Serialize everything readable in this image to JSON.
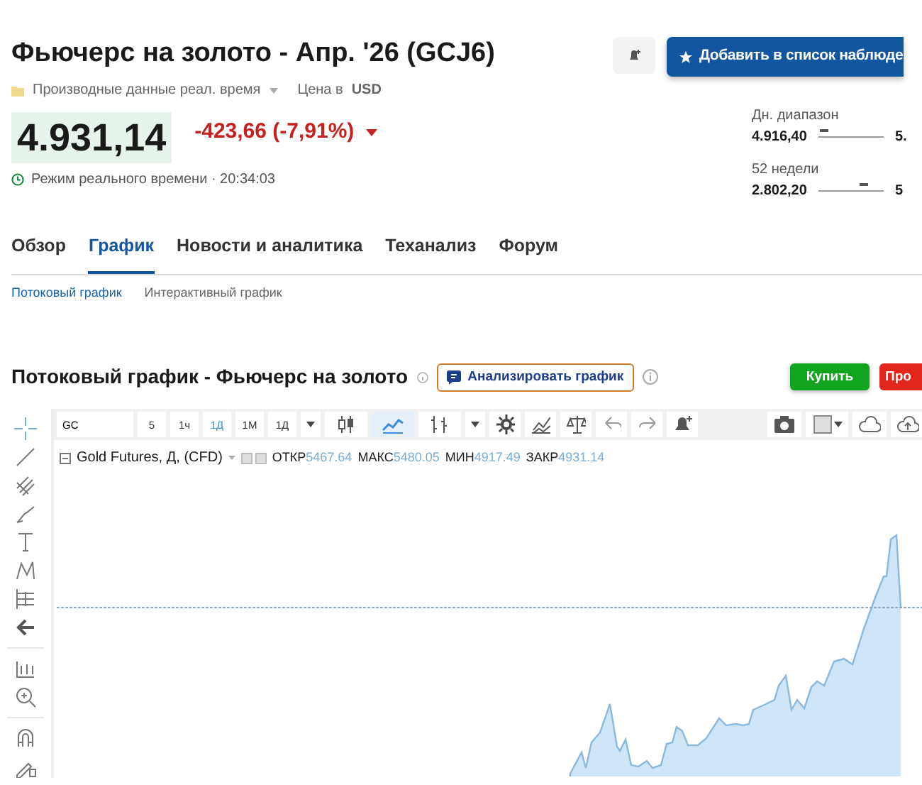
{
  "header": {
    "title": "Фьючерс на золото - Апр. '26 (GCJ6)",
    "data_note": "Производные данные реал. время",
    "currency_label": "Цена в",
    "currency": "USD",
    "watchlist_button": "Добавить в список наблюде"
  },
  "quote": {
    "price": "4.931,14",
    "change": "-423,66 (-7,91%)",
    "falling": true,
    "time_note": "Режим реального времени · 20:34:03"
  },
  "ranges": [
    {
      "label": "Дн. диапазон",
      "low": "4.916,40",
      "high": "5.",
      "level": 0.03
    },
    {
      "label": "52 недели",
      "low": "2.802,20",
      "high": "5",
      "level": 0.72
    }
  ],
  "tabs": [
    {
      "label": "Обзор",
      "selected": false
    },
    {
      "label": "График",
      "selected": true
    },
    {
      "label": "Новости и аналитика",
      "selected": false
    },
    {
      "label": "Теханализ",
      "selected": false
    },
    {
      "label": "Форум",
      "selected": false
    }
  ],
  "subtabs": [
    {
      "label": "Потоковый график",
      "selected": true
    },
    {
      "label": "Интерактивный график",
      "selected": false
    }
  ],
  "chart_section": {
    "title": "Потоковый график - Фьючерс на золото",
    "analyze_button": "Анализировать график",
    "buy_button": "Купить",
    "sell_button": "Про"
  },
  "toolbar": {
    "symbol": "GC",
    "intervals": [
      {
        "label": "5",
        "selected": false
      },
      {
        "label": "1ч",
        "selected": false
      },
      {
        "label": "1Д",
        "selected": true
      },
      {
        "label": "1М",
        "selected": false
      },
      {
        "label": "1Д",
        "selected": false
      }
    ],
    "chart_types": [
      {
        "kind": "candles",
        "selected": false
      },
      {
        "kind": "line",
        "selected": true
      },
      {
        "kind": "bars",
        "selected": false
      }
    ]
  },
  "legend": {
    "name": "Gold Futures, Д, (CFD)",
    "fields": [
      {
        "label": "ОТКР",
        "value": "5467.64"
      },
      {
        "label": "МАКС",
        "value": "5480.05"
      },
      {
        "label": "МИН",
        "value": "4917.49"
      },
      {
        "label": "ЗАКР",
        "value": "4931.14"
      }
    ]
  }
}
